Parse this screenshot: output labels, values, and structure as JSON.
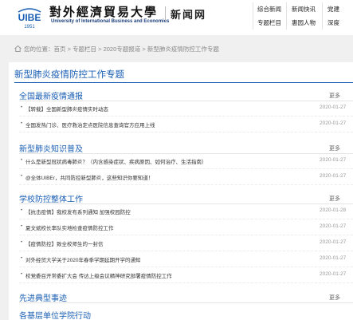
{
  "header": {
    "brand_cn": "對外經濟貿易大學",
    "brand_en": "University of International Business and Economics",
    "seal_year": "1951",
    "site_name": "新闻网",
    "nav": [
      {
        "label": "综合新闻"
      },
      {
        "label": "新闻快讯"
      },
      {
        "label": "党建"
      },
      {
        "label": "专题栏目"
      },
      {
        "label": "惠园人物"
      },
      {
        "label": "深度"
      }
    ],
    "accent": "#1a5fb4"
  },
  "breadcrumb": {
    "text": "您的位置：首页 > 专题栏目 > 2020专题报道 > 新型肺炎疫情防控工作专题",
    "icon": "home-icon"
  },
  "page_title": "新型肺炎疫情防控工作专题",
  "sections": [
    {
      "title": "全国最新疫情通报",
      "more": "更多",
      "items": [
        {
          "text": "【转载】全国新型肺炎疫情实时动态",
          "date": "2020-01-27"
        },
        {
          "text": "全国发热门诊、医疗救治定点医院信息查询官方应用上线",
          "date": "2020-01-27"
        }
      ]
    },
    {
      "title": "新型肺炎知识普及",
      "more": "更多",
      "items": [
        {
          "text": "什么是新型冠状病毒肺炎？（内含感染症状、疾病原因、如何治疗、生活指南）",
          "date": "2020-01-27"
        },
        {
          "text": "@全体UIBEr，共同防控新型肺炎，这些知识你要知道！",
          "date": "2020-01-27"
        }
      ]
    },
    {
      "title": "学校防控整体工作",
      "more": "更多",
      "items": [
        {
          "text": "【抗击疫情】我校发布系列通知 加强校园防控",
          "date": "2020-01-28"
        },
        {
          "text": "夏文斌校长率队实地检查疫情防控工作",
          "date": "2020-01-27"
        },
        {
          "text": "【疫情防控】致全校师生的一封信",
          "date": "2020-01-27"
        },
        {
          "text": "对外经贸大学关于2020年春季学期延期开学的通知",
          "date": "2020-01-27"
        },
        {
          "text": "校党委召开常委扩大会 传达上级会议精神研究部署疫情防控工作",
          "date": "2020-01-27"
        }
      ]
    },
    {
      "title": "先进典型事迹",
      "more": "更多",
      "items": []
    },
    {
      "title": "各基层单位学院行动",
      "more": "",
      "items": []
    }
  ]
}
